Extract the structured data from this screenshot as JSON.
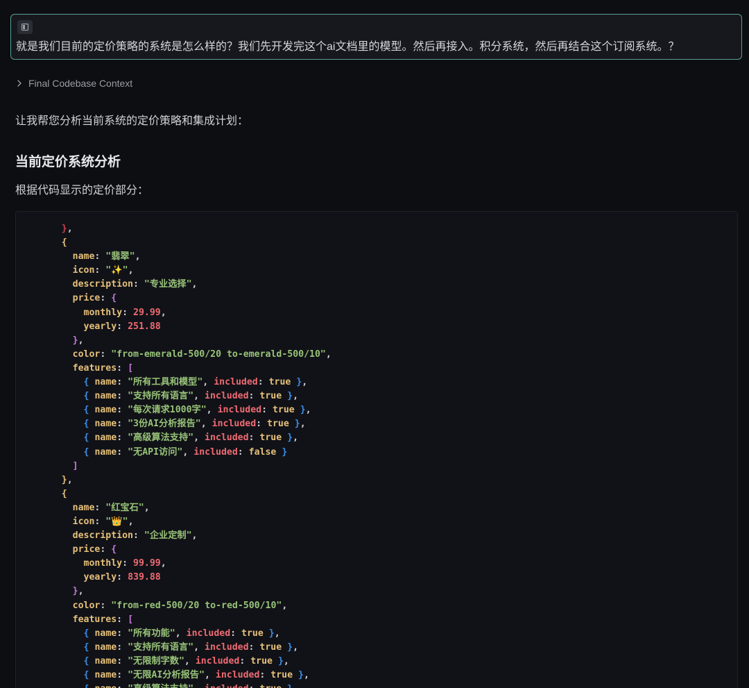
{
  "user_message": {
    "icon": "context-icon",
    "text": "就是我们目前的定价策略的系统是怎么样的？我们先开发完这个ai文档里的模型。然后再接入。积分系统，然后再结合这个订阅系统。？"
  },
  "context_toggle": {
    "icon": "chevron-right-icon",
    "label": "Final Codebase Context"
  },
  "response": {
    "intro": "让我帮您分析当前系统的定价策略和集成计划：",
    "heading": "当前定价系统分析",
    "subtext": "根据代码显示的定价部分："
  },
  "colors": {
    "background": "#0d0e12",
    "user_message_border": "#5a9f96",
    "code_key": "#e5c07b",
    "code_string": "#98c379",
    "code_number": "#ef6b73",
    "code_keyword": "#ef6b73"
  },
  "code_lines": [
    [
      [
        "    ",
        "p"
      ],
      [
        "}",
        "b0"
      ],
      [
        ",",
        "p"
      ]
    ],
    [
      [
        "    ",
        "p"
      ],
      [
        "{",
        "b1"
      ]
    ],
    [
      [
        "      ",
        "p"
      ],
      [
        "name",
        "k"
      ],
      [
        ": ",
        "p"
      ],
      [
        "\"翡翠\"",
        "s"
      ],
      [
        ",",
        "p"
      ]
    ],
    [
      [
        "      ",
        "p"
      ],
      [
        "icon",
        "k"
      ],
      [
        ": ",
        "p"
      ],
      [
        "\"✨\"",
        "s"
      ],
      [
        ",",
        "p"
      ]
    ],
    [
      [
        "      ",
        "p"
      ],
      [
        "description",
        "k"
      ],
      [
        ": ",
        "p"
      ],
      [
        "\"专业选择\"",
        "s"
      ],
      [
        ",",
        "p"
      ]
    ],
    [
      [
        "      ",
        "p"
      ],
      [
        "price",
        "k"
      ],
      [
        ": ",
        "p"
      ],
      [
        "{",
        "b2"
      ]
    ],
    [
      [
        "        ",
        "p"
      ],
      [
        "monthly",
        "k"
      ],
      [
        ": ",
        "p"
      ],
      [
        "29.99",
        "n"
      ],
      [
        ",",
        "p"
      ]
    ],
    [
      [
        "        ",
        "p"
      ],
      [
        "yearly",
        "k"
      ],
      [
        ": ",
        "p"
      ],
      [
        "251.88",
        "n"
      ]
    ],
    [
      [
        "      ",
        "p"
      ],
      [
        "}",
        "b2"
      ],
      [
        ",",
        "p"
      ]
    ],
    [
      [
        "      ",
        "p"
      ],
      [
        "color",
        "k"
      ],
      [
        ": ",
        "p"
      ],
      [
        "\"from-emerald-500/20 to-emerald-500/10\"",
        "s"
      ],
      [
        ",",
        "p"
      ]
    ],
    [
      [
        "      ",
        "p"
      ],
      [
        "features",
        "k"
      ],
      [
        ": ",
        "p"
      ],
      [
        "[",
        "b2"
      ]
    ],
    [
      [
        "        ",
        "p"
      ],
      [
        "{",
        "b3"
      ],
      [
        " ",
        "p"
      ],
      [
        "name",
        "k"
      ],
      [
        ": ",
        "p"
      ],
      [
        "\"所有工具和模型\"",
        "s"
      ],
      [
        ", ",
        "p"
      ],
      [
        "included",
        "kw"
      ],
      [
        ": ",
        "p"
      ],
      [
        "true",
        "k"
      ],
      [
        " ",
        "p"
      ],
      [
        "}",
        "b3"
      ],
      [
        ",",
        "p"
      ]
    ],
    [
      [
        "        ",
        "p"
      ],
      [
        "{",
        "b3"
      ],
      [
        " ",
        "p"
      ],
      [
        "name",
        "k"
      ],
      [
        ": ",
        "p"
      ],
      [
        "\"支持所有语言\"",
        "s"
      ],
      [
        ", ",
        "p"
      ],
      [
        "included",
        "kw"
      ],
      [
        ": ",
        "p"
      ],
      [
        "true",
        "k"
      ],
      [
        " ",
        "p"
      ],
      [
        "}",
        "b3"
      ],
      [
        ",",
        "p"
      ]
    ],
    [
      [
        "        ",
        "p"
      ],
      [
        "{",
        "b3"
      ],
      [
        " ",
        "p"
      ],
      [
        "name",
        "k"
      ],
      [
        ": ",
        "p"
      ],
      [
        "\"每次请求1000字\"",
        "s"
      ],
      [
        ", ",
        "p"
      ],
      [
        "included",
        "kw"
      ],
      [
        ": ",
        "p"
      ],
      [
        "true",
        "k"
      ],
      [
        " ",
        "p"
      ],
      [
        "}",
        "b3"
      ],
      [
        ",",
        "p"
      ]
    ],
    [
      [
        "        ",
        "p"
      ],
      [
        "{",
        "b3"
      ],
      [
        " ",
        "p"
      ],
      [
        "name",
        "k"
      ],
      [
        ": ",
        "p"
      ],
      [
        "\"3份AI分析报告\"",
        "s"
      ],
      [
        ", ",
        "p"
      ],
      [
        "included",
        "kw"
      ],
      [
        ": ",
        "p"
      ],
      [
        "true",
        "k"
      ],
      [
        " ",
        "p"
      ],
      [
        "}",
        "b3"
      ],
      [
        ",",
        "p"
      ]
    ],
    [
      [
        "        ",
        "p"
      ],
      [
        "{",
        "b3"
      ],
      [
        " ",
        "p"
      ],
      [
        "name",
        "k"
      ],
      [
        ": ",
        "p"
      ],
      [
        "\"高级算法支持\"",
        "s"
      ],
      [
        ", ",
        "p"
      ],
      [
        "included",
        "kw"
      ],
      [
        ": ",
        "p"
      ],
      [
        "true",
        "k"
      ],
      [
        " ",
        "p"
      ],
      [
        "}",
        "b3"
      ],
      [
        ",",
        "p"
      ]
    ],
    [
      [
        "        ",
        "p"
      ],
      [
        "{",
        "b3"
      ],
      [
        " ",
        "p"
      ],
      [
        "name",
        "k"
      ],
      [
        ": ",
        "p"
      ],
      [
        "\"无API访问\"",
        "s"
      ],
      [
        ", ",
        "p"
      ],
      [
        "included",
        "kw"
      ],
      [
        ": ",
        "p"
      ],
      [
        "false",
        "k"
      ],
      [
        " ",
        "p"
      ],
      [
        "}",
        "b3"
      ]
    ],
    [
      [
        "      ",
        "p"
      ],
      [
        "]",
        "b2"
      ]
    ],
    [
      [
        "    ",
        "p"
      ],
      [
        "}",
        "b1"
      ],
      [
        ",",
        "p"
      ]
    ],
    [
      [
        "    ",
        "p"
      ],
      [
        "{",
        "b1"
      ]
    ],
    [
      [
        "      ",
        "p"
      ],
      [
        "name",
        "k"
      ],
      [
        ": ",
        "p"
      ],
      [
        "\"红宝石\"",
        "s"
      ],
      [
        ",",
        "p"
      ]
    ],
    [
      [
        "      ",
        "p"
      ],
      [
        "icon",
        "k"
      ],
      [
        ": ",
        "p"
      ],
      [
        "\"👑\"",
        "s"
      ],
      [
        ",",
        "p"
      ]
    ],
    [
      [
        "      ",
        "p"
      ],
      [
        "description",
        "k"
      ],
      [
        ": ",
        "p"
      ],
      [
        "\"企业定制\"",
        "s"
      ],
      [
        ",",
        "p"
      ]
    ],
    [
      [
        "      ",
        "p"
      ],
      [
        "price",
        "k"
      ],
      [
        ": ",
        "p"
      ],
      [
        "{",
        "b2"
      ]
    ],
    [
      [
        "        ",
        "p"
      ],
      [
        "monthly",
        "k"
      ],
      [
        ": ",
        "p"
      ],
      [
        "99.99",
        "n"
      ],
      [
        ",",
        "p"
      ]
    ],
    [
      [
        "        ",
        "p"
      ],
      [
        "yearly",
        "k"
      ],
      [
        ": ",
        "p"
      ],
      [
        "839.88",
        "n"
      ]
    ],
    [
      [
        "      ",
        "p"
      ],
      [
        "}",
        "b2"
      ],
      [
        ",",
        "p"
      ]
    ],
    [
      [
        "      ",
        "p"
      ],
      [
        "color",
        "k"
      ],
      [
        ": ",
        "p"
      ],
      [
        "\"from-red-500/20 to-red-500/10\"",
        "s"
      ],
      [
        ",",
        "p"
      ]
    ],
    [
      [
        "      ",
        "p"
      ],
      [
        "features",
        "k"
      ],
      [
        ": ",
        "p"
      ],
      [
        "[",
        "b2"
      ]
    ],
    [
      [
        "        ",
        "p"
      ],
      [
        "{",
        "b3"
      ],
      [
        " ",
        "p"
      ],
      [
        "name",
        "k"
      ],
      [
        ": ",
        "p"
      ],
      [
        "\"所有功能\"",
        "s"
      ],
      [
        ", ",
        "p"
      ],
      [
        "included",
        "kw"
      ],
      [
        ": ",
        "p"
      ],
      [
        "true",
        "k"
      ],
      [
        " ",
        "p"
      ],
      [
        "}",
        "b3"
      ],
      [
        ",",
        "p"
      ]
    ],
    [
      [
        "        ",
        "p"
      ],
      [
        "{",
        "b3"
      ],
      [
        " ",
        "p"
      ],
      [
        "name",
        "k"
      ],
      [
        ": ",
        "p"
      ],
      [
        "\"支持所有语言\"",
        "s"
      ],
      [
        ", ",
        "p"
      ],
      [
        "included",
        "kw"
      ],
      [
        ": ",
        "p"
      ],
      [
        "true",
        "k"
      ],
      [
        " ",
        "p"
      ],
      [
        "}",
        "b3"
      ],
      [
        ",",
        "p"
      ]
    ],
    [
      [
        "        ",
        "p"
      ],
      [
        "{",
        "b3"
      ],
      [
        " ",
        "p"
      ],
      [
        "name",
        "k"
      ],
      [
        ": ",
        "p"
      ],
      [
        "\"无限制字数\"",
        "s"
      ],
      [
        ", ",
        "p"
      ],
      [
        "included",
        "kw"
      ],
      [
        ": ",
        "p"
      ],
      [
        "true",
        "k"
      ],
      [
        " ",
        "p"
      ],
      [
        "}",
        "b3"
      ],
      [
        ",",
        "p"
      ]
    ],
    [
      [
        "        ",
        "p"
      ],
      [
        "{",
        "b3"
      ],
      [
        " ",
        "p"
      ],
      [
        "name",
        "k"
      ],
      [
        ": ",
        "p"
      ],
      [
        "\"无限AI分析报告\"",
        "s"
      ],
      [
        ", ",
        "p"
      ],
      [
        "included",
        "kw"
      ],
      [
        ": ",
        "p"
      ],
      [
        "true",
        "k"
      ],
      [
        " ",
        "p"
      ],
      [
        "}",
        "b3"
      ],
      [
        ",",
        "p"
      ]
    ],
    [
      [
        "        ",
        "p"
      ],
      [
        "{",
        "b3"
      ],
      [
        " ",
        "p"
      ],
      [
        "name",
        "k"
      ],
      [
        ": ",
        "p"
      ],
      [
        "\"高级算法支持\"",
        "s"
      ],
      [
        ", ",
        "p"
      ],
      [
        "included",
        "kw"
      ],
      [
        ": ",
        "p"
      ],
      [
        "true",
        "k"
      ],
      [
        " ",
        "p"
      ],
      [
        "}",
        "b3"
      ]
    ]
  ]
}
